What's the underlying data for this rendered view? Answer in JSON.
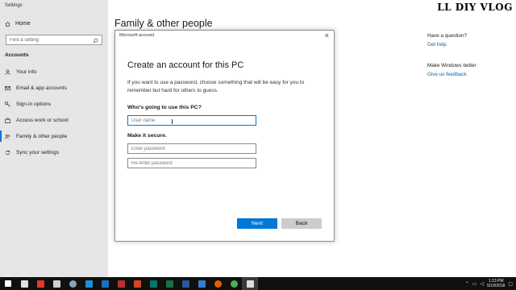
{
  "app": {
    "title": "Settings"
  },
  "sidebar": {
    "home_label": "Home",
    "search_placeholder": "Find a setting",
    "section_header": "Accounts",
    "items": [
      {
        "label": "Your info",
        "icon": "person-icon"
      },
      {
        "label": "Email & app accounts",
        "icon": "mail-icon"
      },
      {
        "label": "Sign-in options",
        "icon": "key-icon"
      },
      {
        "label": "Access work or school",
        "icon": "briefcase-icon"
      },
      {
        "label": "Family & other people",
        "icon": "people-icon",
        "active": true
      },
      {
        "label": "Sync your settings",
        "icon": "sync-icon"
      }
    ]
  },
  "main": {
    "title": "Family & other people"
  },
  "watermark": "LL DIY VLOG",
  "right_column": {
    "question_heading": "Have a question?",
    "help_link": "Get help",
    "improve_heading": "Make Windows better",
    "feedback_link": "Give us feedback"
  },
  "dialog": {
    "window_title": "Microsoft account",
    "close_glyph": "×",
    "heading": "Create an account for this PC",
    "description": "If you want to use a password, choose something that will be easy for you to remember but hard for others to guess.",
    "who_label": "Who's going to use this PC?",
    "username_placeholder": "User name",
    "secure_label": "Make it secure.",
    "password_placeholder": "Enter password",
    "reenter_placeholder": "Re-enter password",
    "next_label": "Next",
    "back_label": "Back"
  },
  "taskbar": {
    "icons": [
      {
        "name": "start-icon",
        "color": "#ffffff"
      },
      {
        "name": "shield-app-icon",
        "color": "#e0e0e0"
      },
      {
        "name": "red-app-icon",
        "color": "#e23a2a"
      },
      {
        "name": "mic-app-icon",
        "color": "#d0d0d0"
      },
      {
        "name": "steam-icon",
        "color": "#8aa1b8"
      },
      {
        "name": "files-icon",
        "color": "#1f8fd6"
      },
      {
        "name": "outlook-icon",
        "color": "#1e6fc0"
      },
      {
        "name": "access-icon",
        "color": "#b7322e"
      },
      {
        "name": "powerpoint-icon",
        "color": "#d24726"
      },
      {
        "name": "publisher-icon",
        "color": "#077568"
      },
      {
        "name": "excel-icon",
        "color": "#1d7044"
      },
      {
        "name": "word-icon",
        "color": "#2b5797"
      },
      {
        "name": "store-icon",
        "color": "#3b7bd4"
      },
      {
        "name": "firefox-icon",
        "color": "#e66000"
      },
      {
        "name": "chrome-icon",
        "color": "#4caf50"
      },
      {
        "name": "settings-gear-icon",
        "color": "#dddddd",
        "active": true
      }
    ],
    "clock_time": "1:13 PM",
    "clock_date": "5/19/2018"
  }
}
